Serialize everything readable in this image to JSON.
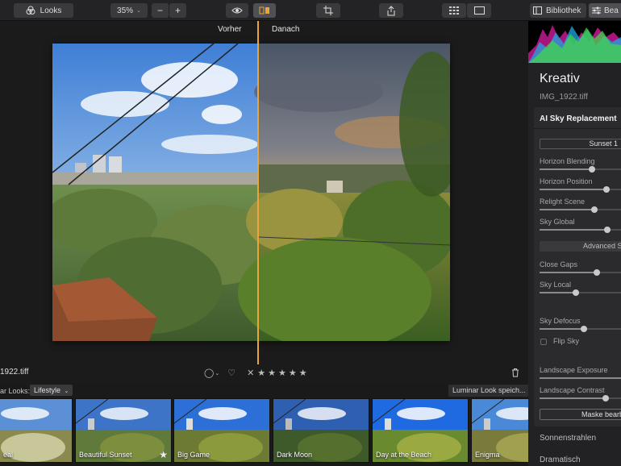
{
  "toolbar": {
    "looks_label": "Looks",
    "zoom": "35%",
    "zoom_minus": "−",
    "zoom_plus": "+",
    "library_label": "Bibliothek",
    "edit_label": "Bea"
  },
  "canvas": {
    "before_label": "Vorher",
    "after_label": "Danach",
    "filename": "1922.tiff"
  },
  "rating": {
    "flag_icon": "circle-chevron-icon",
    "stars": [
      "★",
      "★",
      "★",
      "★",
      "★"
    ]
  },
  "looks": {
    "prefix": "ar Looks:",
    "category": "Lifestyle",
    "save_button": "Luminar Look speich...",
    "items": [
      {
        "label": "eal"
      },
      {
        "label": "Beautiful Sunset"
      },
      {
        "label": "Big Game"
      },
      {
        "label": "Dark Moon"
      },
      {
        "label": "Day at the Beach"
      },
      {
        "label": "Enigma"
      }
    ]
  },
  "panel": {
    "title": "Kreativ",
    "file": "IMG_1922.tiff",
    "tool": {
      "title": "AI Sky Replacement",
      "sky_value": "Sunset 1",
      "sliders_top": [
        {
          "label": "Horizon Blending",
          "value": 0.6
        },
        {
          "label": "Horizon Position",
          "value": 0.77
        },
        {
          "label": "Relight Scene",
          "value": 0.63
        },
        {
          "label": "Sky Global",
          "value": 0.78
        }
      ],
      "advanced_label": "Advanced Set",
      "sliders_adv": [
        {
          "label": "Close Gaps",
          "value": 0.66
        },
        {
          "label": "Sky Local",
          "value": 0.4
        },
        {
          "label": "Sky Defocus",
          "value": 0.5
        }
      ],
      "flip_label": "Flip Sky",
      "sliders_land": [
        {
          "label": "Landscape Exposure",
          "value": 1.0
        },
        {
          "label": "Landscape Contrast",
          "value": 0.76
        }
      ],
      "mask_button": "Maske bearbe"
    },
    "more_tools": [
      "Sonnenstrahlen",
      "Dramatisch"
    ]
  },
  "colors": {
    "split_line": "#e8a63a",
    "background": "#1a1a1b"
  }
}
